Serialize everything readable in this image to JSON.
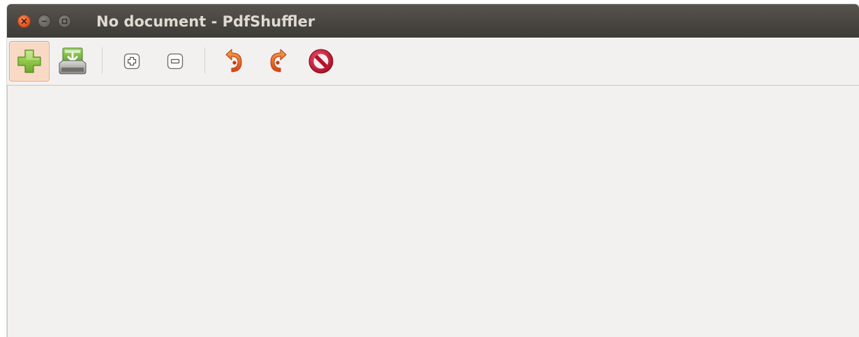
{
  "window": {
    "title": "No document - PdfShuffler"
  },
  "window_controls": [
    {
      "name": "close",
      "icon": "close-icon",
      "color": "#e05a28"
    },
    {
      "name": "minimize",
      "icon": "minimize-icon",
      "color": "#6b6862"
    },
    {
      "name": "maximize",
      "icon": "maximize-icon",
      "color": "#6b6862"
    }
  ],
  "toolbar": {
    "buttons": [
      {
        "name": "import",
        "icon": "add-plus-icon",
        "active": true
      },
      {
        "name": "export",
        "icon": "save-disk-icon",
        "active": false
      },
      {
        "name": "zoom-in",
        "icon": "zoom-in-icon",
        "active": false
      },
      {
        "name": "zoom-out",
        "icon": "zoom-out-icon",
        "active": false
      },
      {
        "name": "rotate-left",
        "icon": "rotate-left-icon",
        "active": false
      },
      {
        "name": "rotate-right",
        "icon": "rotate-right-icon",
        "active": false
      },
      {
        "name": "delete",
        "icon": "delete-stop-icon",
        "active": false
      }
    ]
  },
  "colors": {
    "titlebar": "#3d3b37",
    "title_text": "#dfdbd2",
    "background": "#f2f1f0",
    "accent_orange": "#e8611c",
    "accent_green": "#8cc63f",
    "delete_red": "#c0102a"
  }
}
